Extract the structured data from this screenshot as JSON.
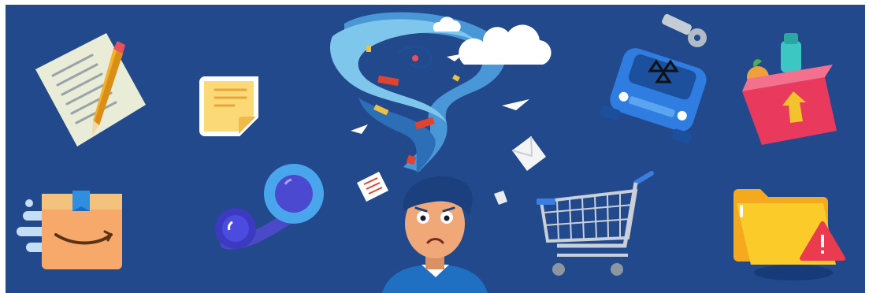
{
  "banner": {
    "background_color": "#22498c",
    "icons": [
      "notepad-pencil-icon",
      "sticky-note-icon",
      "tornado-icon",
      "cloud-icon",
      "email-envelope-icon",
      "car-key-icon",
      "grocery-box-icon",
      "amazon-package-icon",
      "voicemail-icon",
      "shopping-cart-icon",
      "folder-warning-icon"
    ]
  }
}
